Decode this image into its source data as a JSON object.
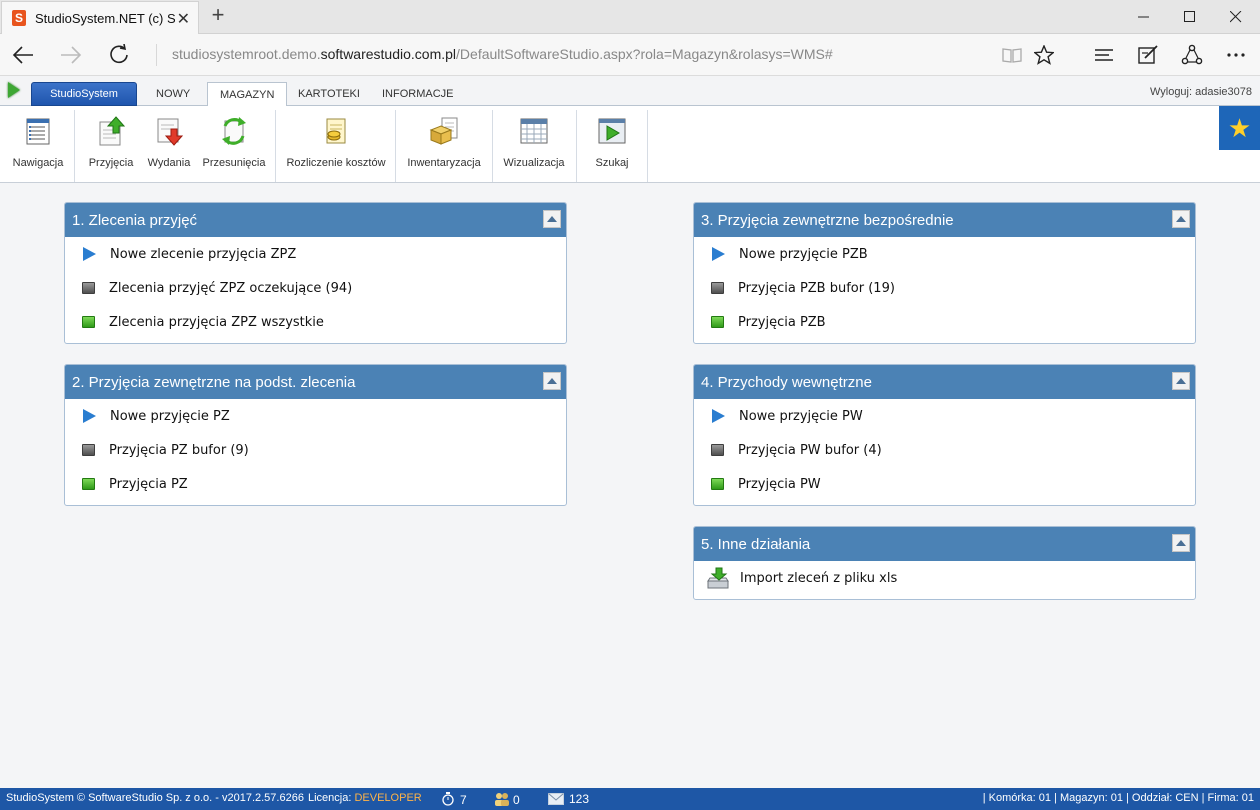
{
  "browser": {
    "tab_title": "StudioSystem.NET (c) So",
    "favicon_letter": "S",
    "url_prefix": "studiosystemroot.demo.",
    "url_host": "softwarestudio.com.pl",
    "url_suffix": "/DefaultSoftwareStudio.aspx?rola=Magazyn&rolasys=WMS#",
    "icons": [
      "back-icon",
      "forward-icon",
      "reload-icon",
      "reading-view-icon",
      "favorite-star-icon",
      "hub-icon",
      "web-note-icon",
      "share-icon",
      "more-icon"
    ]
  },
  "app_tabs": {
    "brand": "StudioSystem",
    "items": [
      "NOWY",
      "MAGAZYN",
      "KARTOTEKI",
      "INFORMACJE"
    ],
    "active": "MAGAZYN",
    "logout": "Wyloguj: adasie3078"
  },
  "ribbon": {
    "buttons": [
      {
        "label": "Nawigacja",
        "icon": "navigation-list-icon"
      },
      {
        "label": "Przyjęcia",
        "icon": "doc-arrow-up-icon"
      },
      {
        "label": "Wydania",
        "icon": "doc-arrow-down-icon"
      },
      {
        "label": "Przesunięcia",
        "icon": "doc-cycle-icon"
      },
      {
        "label": "Rozliczenie kosztów",
        "icon": "doc-coins-icon"
      },
      {
        "label": "Inwentaryzacja",
        "icon": "inventory-box-icon"
      },
      {
        "label": "Wizualizacja",
        "icon": "calendar-grid-icon"
      },
      {
        "label": "Szukaj",
        "icon": "search-play-icon"
      }
    ],
    "favorite_icon": "star-icon"
  },
  "panels": [
    {
      "title": "1. Zlecenia przyjęć",
      "rows": [
        {
          "icon": "play",
          "label": "Nowe zlecenie przyjęcia ZPZ"
        },
        {
          "icon": "gray",
          "label": "Zlecenia przyjęć ZPZ oczekujące (94)"
        },
        {
          "icon": "green",
          "label": "Zlecenia przyjęcia ZPZ wszystkie"
        }
      ]
    },
    {
      "title": "2. Przyjęcia zewnętrzne na podst. zlecenia",
      "rows": [
        {
          "icon": "play",
          "label": "Nowe przyjęcie PZ"
        },
        {
          "icon": "gray",
          "label": "Przyjęcia PZ bufor (9)"
        },
        {
          "icon": "green",
          "label": "Przyjęcia PZ"
        }
      ]
    },
    {
      "title": "3. Przyjęcia zewnętrzne bezpośrednie",
      "rows": [
        {
          "icon": "play",
          "label": "Nowe przyjęcie PZB"
        },
        {
          "icon": "gray",
          "label": "Przyjęcia PZB bufor (19)"
        },
        {
          "icon": "green",
          "label": "Przyjęcia PZB"
        }
      ]
    },
    {
      "title": "4. Przychody wewnętrzne",
      "rows": [
        {
          "icon": "play",
          "label": "Nowe przyjęcie PW"
        },
        {
          "icon": "gray",
          "label": "Przyjęcia PW bufor (4)"
        },
        {
          "icon": "green",
          "label": "Przyjęcia PW"
        }
      ]
    },
    {
      "title": "5. Inne działania",
      "rows": [
        {
          "icon": "import",
          "label": "Import zleceń z pliku xls"
        }
      ]
    }
  ],
  "status": {
    "copyright": "StudioSystem © SoftwareStudio Sp. z o.o. - v2017.2.57.6266",
    "license_label": "Licencja:",
    "license_value": "DEVELOPER",
    "timer_count": "7",
    "users_count": "0",
    "messages_count": "123",
    "location": "| Komórka: 01 | Magazyn: 01 | Oddział: CEN | Firma: 01"
  },
  "colors": {
    "panel_header": "#4b82b5",
    "status_bar": "#1e57a6",
    "brand_tab": "#1f55ad",
    "license_highlight": "#ffb347"
  }
}
